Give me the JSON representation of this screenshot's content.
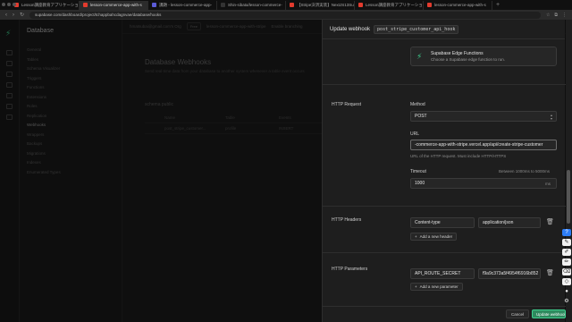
{
  "browser": {
    "tabs": [
      {
        "label": "Lesson講座教育アプリケーション",
        "color": "#e33b2e",
        "active": false
      },
      {
        "label": "lesson-commerce-app-with-s",
        "color": "#e33b2e",
        "active": true
      },
      {
        "label": "課題 - lesson-commerce-app-",
        "color": "#5b5bd6",
        "active": false
      },
      {
        "label": "Shin-sibata/lesson-commerce-",
        "color": "#333333",
        "active": false
      },
      {
        "label": "【Stripe決済実装】NextJS13Supabas",
        "color": "#e33b2e",
        "active": false
      },
      {
        "label": "Lesson講座教育アプリケーション",
        "color": "#e33b2e",
        "active": false
      },
      {
        "label": "lesson-commerce-app-with-s",
        "color": "#e33b2e",
        "active": false
      }
    ],
    "url": "supabase.com/dashboard/project/tchappbahcdagnvae/database/hooks"
  },
  "sidebar": {
    "title": "Database",
    "items": [
      "General",
      "Tables",
      "Schema Visualizer",
      "Triggers",
      "Functions",
      "Extensions",
      "Roles",
      "Replication",
      "Webhooks",
      "Wrappers",
      "Backups",
      "Migrations",
      "Indexes",
      "Enumerated Types"
    ],
    "selected": "Webhooks"
  },
  "topbar": {
    "org": "hmatsubai@gmail.com's Org",
    "plan": "Free",
    "project": "lesson-commerce-app-with-stripe",
    "action": "Enable branching"
  },
  "main": {
    "title": "Database Webhooks",
    "subtitle": "Send real-time data from your database to another system whenever a table event occurs",
    "schema": "schema public",
    "columns": [
      "Name",
      "Table",
      "Events"
    ],
    "rows": [
      {
        "name": "post_stripe_customer...",
        "table": "profile",
        "events": "INSERT"
      }
    ]
  },
  "panel": {
    "title": "Update webhook",
    "webhook_name": "post_stripe_customer_api_hook",
    "edge_fn": {
      "title": "Supabase Edge Functions",
      "desc": "Choose a Supabase edge function to run."
    },
    "http_request": {
      "section": "HTTP Request",
      "method_label": "Method",
      "method_value": "POST",
      "url_label": "URL",
      "url_value": "-commerce-app-with-stripe.vercel.app/api/create-stripe-customer",
      "url_hint": "URL of the HTTP request. Must include HTTP/HTTPS",
      "timeout_label": "Timeout",
      "timeout_hint": "Between 1000ms to 5000ms",
      "timeout_value": "1000",
      "timeout_unit": "ms"
    },
    "headers": {
      "section": "HTTP Headers",
      "key": "Content-type",
      "value": "application/json",
      "add_label": "Add a new header"
    },
    "params": {
      "section": "HTTP Parameters",
      "key": "API_ROUTE_SECRET",
      "value": "f9a9c373a5f4954f6916b852",
      "add_label": "Add a new parameter"
    },
    "footer": {
      "cancel": "Cancel",
      "update": "Update webhook"
    }
  },
  "colors": {
    "accent": "#3ecf8e",
    "panel_bg": "#1e1e1e",
    "input_bg": "#262626"
  }
}
